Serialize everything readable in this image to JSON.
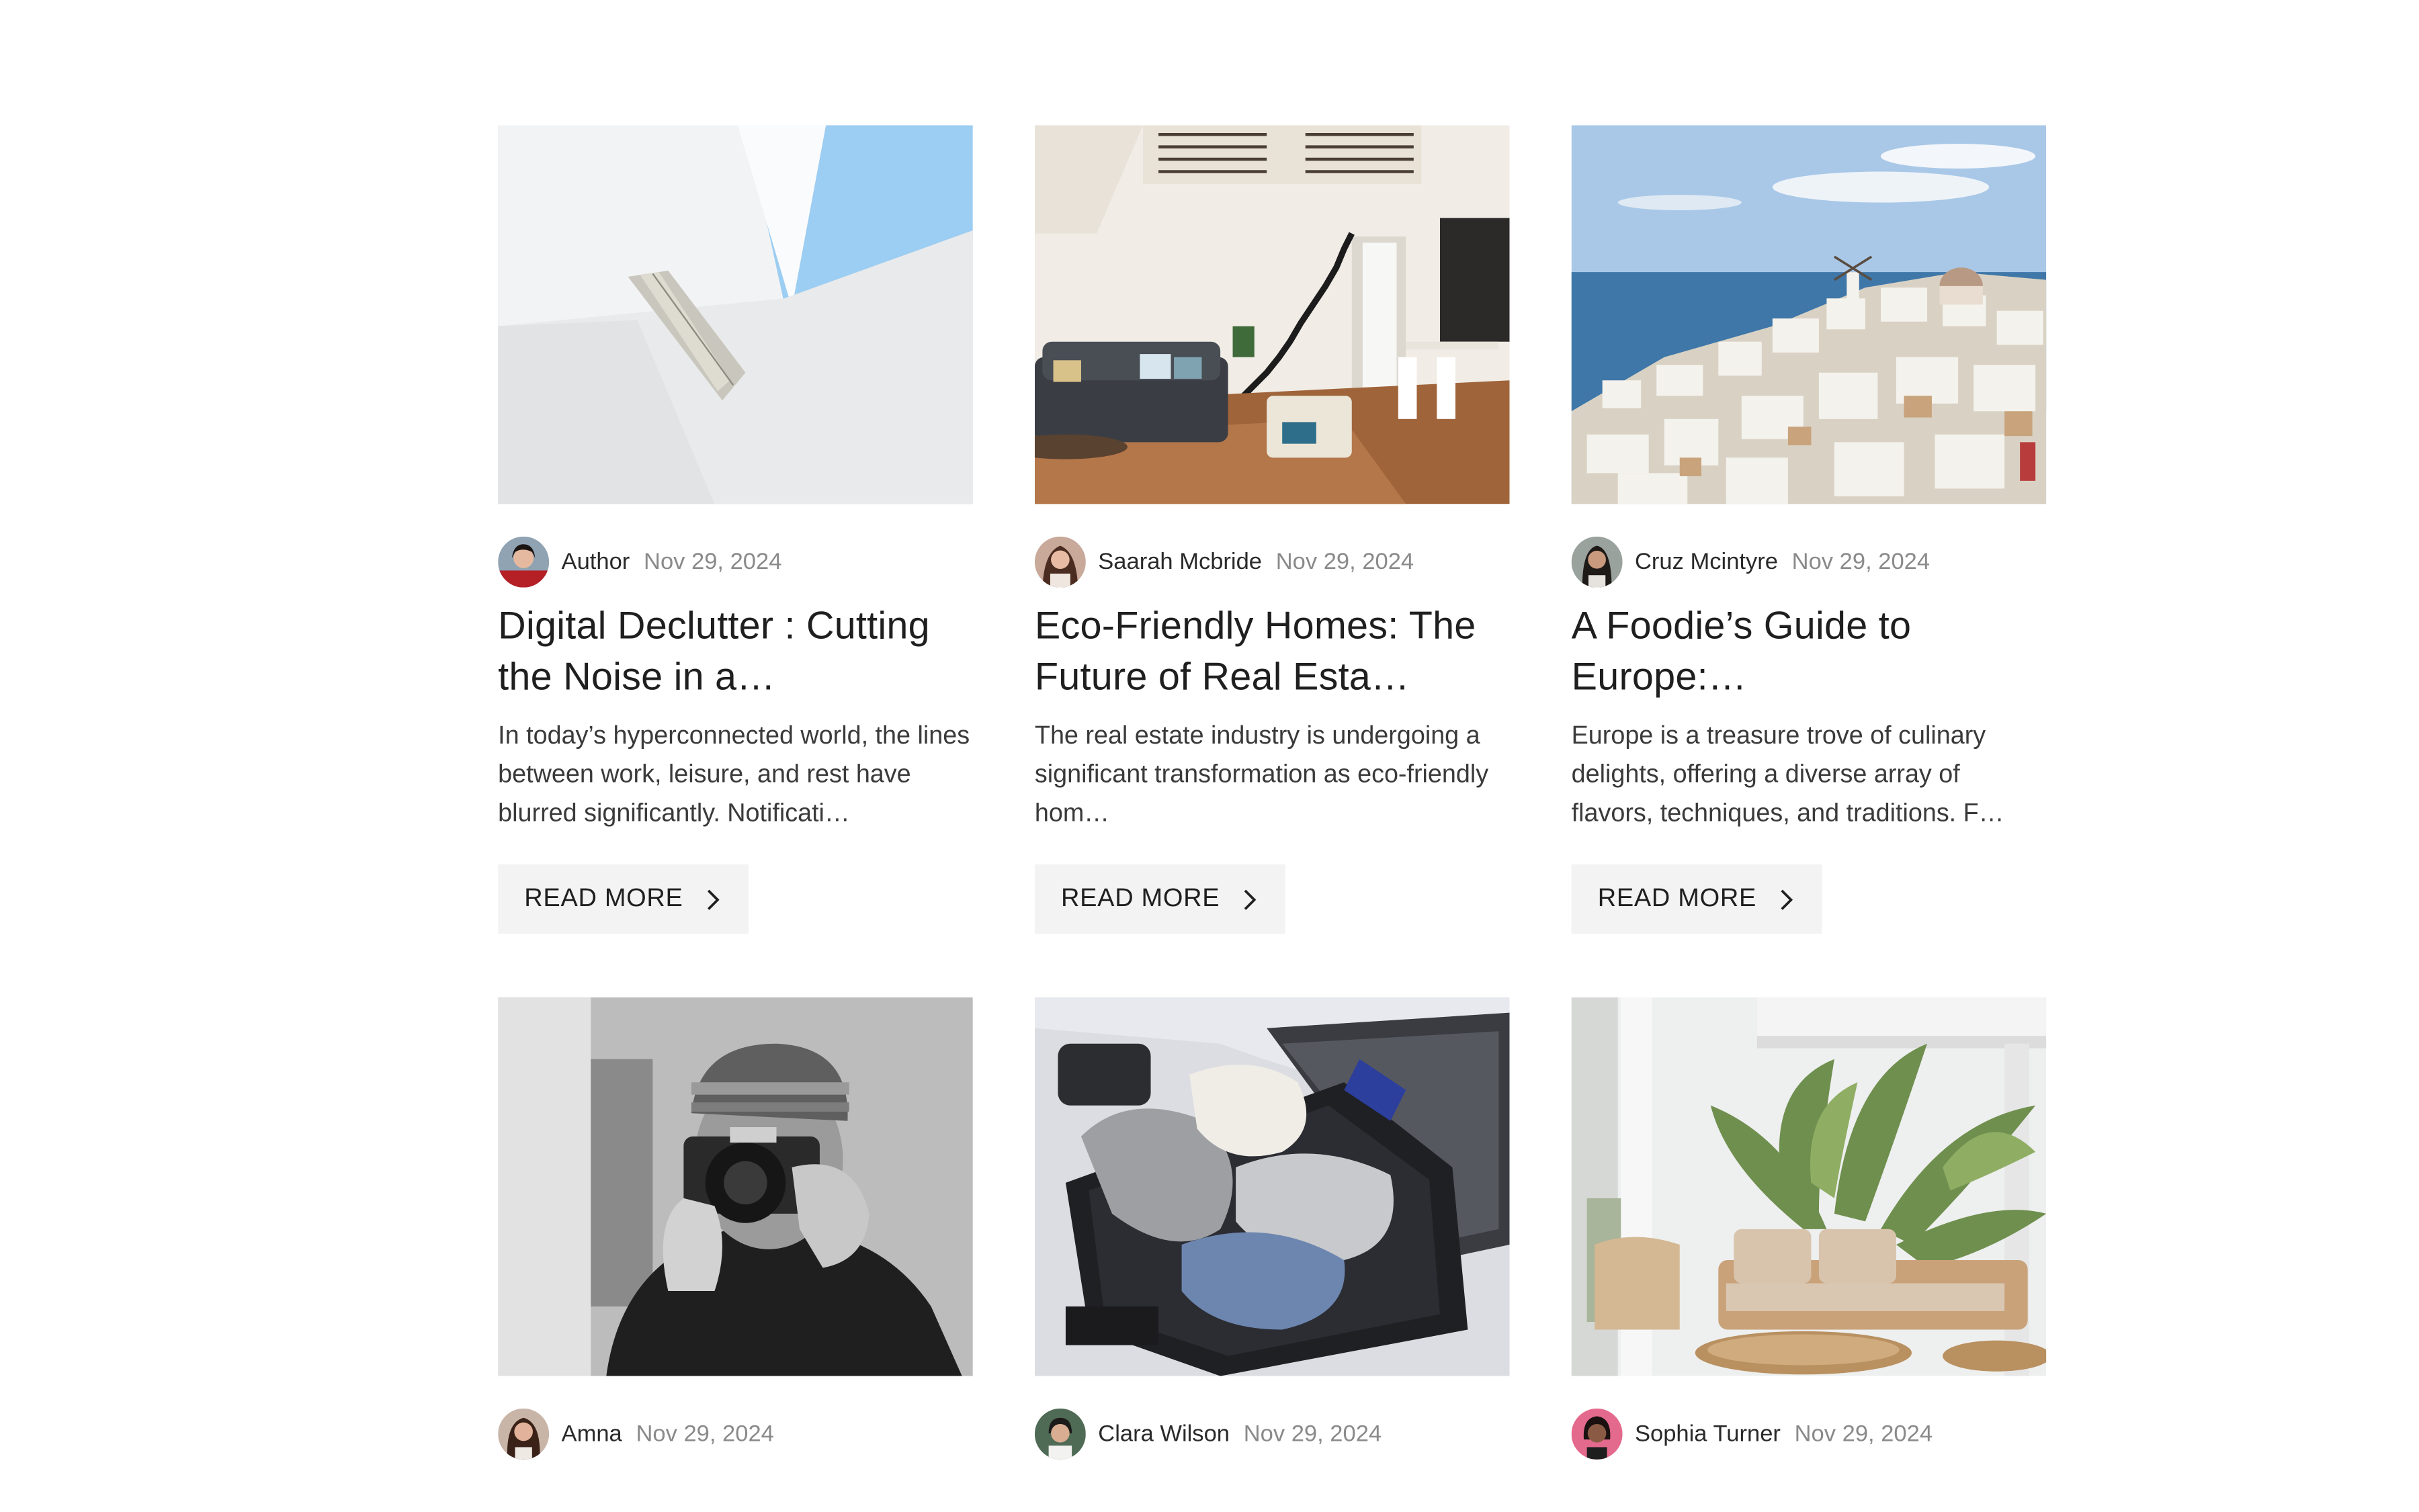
{
  "cards": [
    {
      "author": "Author",
      "date": "Nov 29, 2024",
      "title": "Digital Declutter : Cutting the Noise in a…",
      "excerpt": "In today’s hyperconnected world, the lines between work, leisure, and rest have blurred significantly. Notificati…",
      "button": "READ MORE",
      "image": "architecture-sky-photo",
      "avatar": "woman-red-top-avatar"
    },
    {
      "author": "Saarah Mcbride",
      "date": "Nov 29, 2024",
      "title": "Eco-Friendly Homes: The Future of Real Esta…",
      "excerpt": "The real estate industry is undergoing a significant transformation as eco-friendly hom…",
      "button": "READ MORE",
      "image": "living-room-staircase-photo",
      "avatar": "woman-brown-hair-avatar"
    },
    {
      "author": "Cruz Mcintyre",
      "date": "Nov 29, 2024",
      "title": "A Foodie’s Guide to Europe:…",
      "excerpt": "Europe is a treasure trove of culinary delights, offering a diverse array of flavors, techniques, and traditions. F…",
      "button": "READ MORE",
      "image": "santorini-village-photo",
      "avatar": "woman-dark-hair-avatar"
    },
    {
      "author": "Amna",
      "date": "Nov 29, 2024",
      "title": "",
      "excerpt": "",
      "button": "",
      "image": "photographer-camera-bw-photo",
      "avatar": "woman-long-hair-avatar"
    },
    {
      "author": "Clara Wilson",
      "date": "Nov 29, 2024",
      "title": "",
      "excerpt": "",
      "button": "",
      "image": "packed-suitcase-photo",
      "avatar": "man-green-bg-avatar"
    },
    {
      "author": "Sophia Turner",
      "date": "Nov 29, 2024",
      "title": "",
      "excerpt": "",
      "button": "",
      "image": "rattan-patio-plants-photo",
      "avatar": "woman-pink-bg-avatar"
    }
  ]
}
